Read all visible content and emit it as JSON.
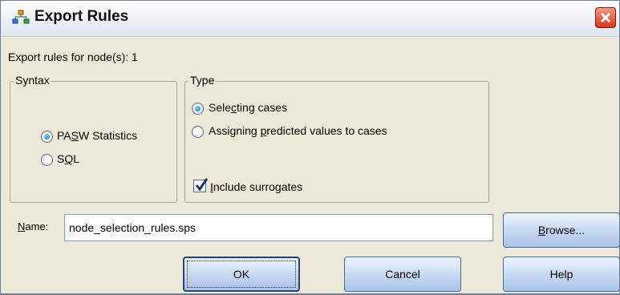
{
  "window": {
    "title": "Export Rules",
    "title_icon": "tree-nodes-icon",
    "close_icon": "close-icon"
  },
  "header_text": "Export rules for node(s): 1",
  "syntax": {
    "legend": "Syntax",
    "options": [
      {
        "label": "PASW Statistics",
        "checked": true
      },
      {
        "label": "SQL",
        "checked": false
      }
    ]
  },
  "type": {
    "legend": "Type",
    "options": [
      {
        "label": "Selecting cases",
        "checked": true
      },
      {
        "label": "Assigning predicted values to cases",
        "checked": false
      }
    ],
    "surrogates": {
      "label": "Include surrogates",
      "checked": true
    }
  },
  "name": {
    "label": "Name:",
    "value": "node_selection_rules.sps"
  },
  "buttons": {
    "browse": "Browse...",
    "ok": "OK",
    "cancel": "Cancel",
    "help": "Help"
  },
  "colors": {
    "dialog_bg": "#ece9d8",
    "button_blue": "#c9daf4",
    "close_red": "#d9381e"
  }
}
